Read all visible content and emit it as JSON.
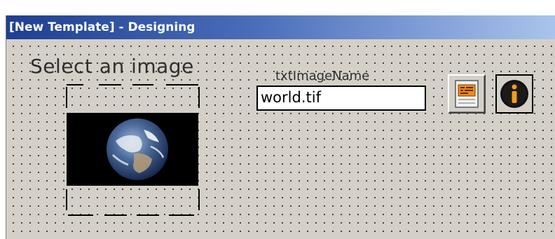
{
  "window": {
    "title": "[New Template] - Designing"
  },
  "canvas": {
    "label_select_image": "Select an image",
    "label_textbox_name": "txtImageName",
    "textbox_value": "world.tif"
  },
  "icons": {
    "image_control": "earth-image",
    "form_button": "form-list-icon",
    "info_button": "info-icon"
  },
  "colors": {
    "title_gradient_start": "#1f3f8f",
    "title_gradient_end": "#a9c4ec",
    "canvas_background": "#d4d0c8",
    "form_icon_accent": "#f08a1c",
    "info_icon_accent": "#f59b1a"
  }
}
